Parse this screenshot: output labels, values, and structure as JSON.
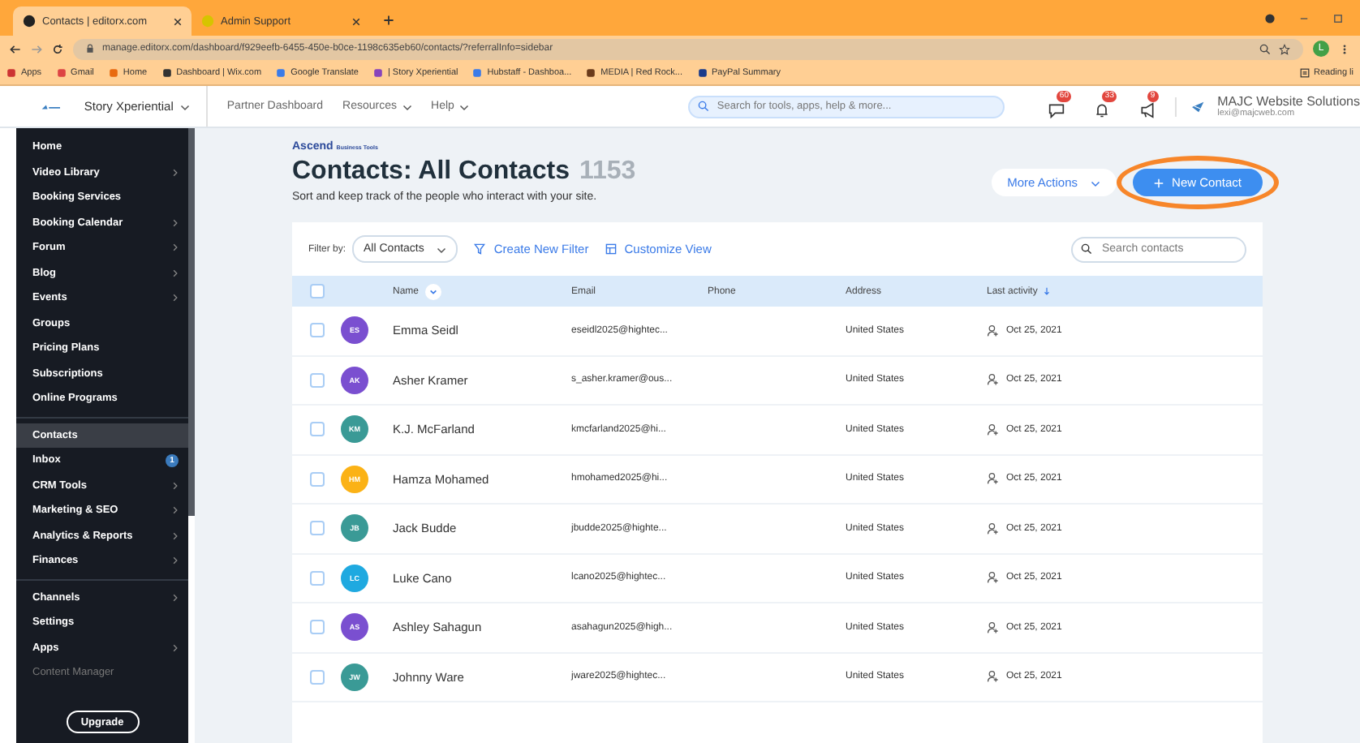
{
  "browser": {
    "tabs": [
      {
        "title": "Contacts | editorx.com",
        "selected": true
      },
      {
        "title": "Admin Support",
        "selected": false
      }
    ],
    "url": "manage.editorx.com/dashboard/f929eefb-6455-450e-b0ce-1198c635eb60/contacts/?referralInfo=sidebar",
    "profile_initial": "L",
    "bookmarks": [
      "Apps",
      "Gmail",
      "Home",
      "Dashboard | Wix.com",
      "Google Translate",
      "| Story Xperiential",
      "Hubstaff - Dashboa...",
      "MEDIA | Red Rock...",
      "PayPal Summary"
    ],
    "reading_list": "Reading li"
  },
  "topbar": {
    "site": "Story Xperiential",
    "menus": [
      "Partner Dashboard",
      "Resources",
      "Help"
    ],
    "search": {
      "placeholder": "Search for tools, apps, help & more..."
    },
    "notifications": [
      {
        "kind": "chat",
        "count": "60"
      },
      {
        "kind": "bell",
        "count": "33"
      },
      {
        "kind": "megaphone",
        "count": "9"
      }
    ],
    "account": {
      "name": "MAJC Website Solutions",
      "email": "lexi@majcweb.com"
    }
  },
  "sidebar": {
    "groups": [
      [
        {
          "label": "Home",
          "arrow": false,
          "selected": false,
          "disabled": false
        },
        {
          "label": "Video Library",
          "arrow": true,
          "selected": false,
          "disabled": false
        },
        {
          "label": "Booking Services",
          "arrow": false,
          "selected": false,
          "disabled": false
        },
        {
          "label": "Booking Calendar",
          "arrow": true,
          "selected": false,
          "disabled": false
        },
        {
          "label": "Forum",
          "arrow": true,
          "selected": false,
          "disabled": false
        },
        {
          "label": "Blog",
          "arrow": true,
          "selected": false,
          "disabled": false
        },
        {
          "label": "Events",
          "arrow": true,
          "selected": false,
          "disabled": false
        },
        {
          "label": "Groups",
          "arrow": false,
          "selected": false,
          "disabled": false
        },
        {
          "label": "Pricing Plans",
          "arrow": false,
          "selected": false,
          "disabled": false
        },
        {
          "label": "Subscriptions",
          "arrow": false,
          "selected": false,
          "disabled": false
        },
        {
          "label": "Online Programs",
          "arrow": false,
          "selected": false,
          "disabled": false
        }
      ],
      [
        {
          "label": "Contacts",
          "arrow": false,
          "selected": true,
          "disabled": false
        },
        {
          "label": "Inbox",
          "arrow": false,
          "badge": "1",
          "selected": false,
          "disabled": false
        },
        {
          "label": "CRM Tools",
          "arrow": true,
          "selected": false,
          "disabled": false
        },
        {
          "label": "Marketing & SEO",
          "arrow": true,
          "selected": false,
          "disabled": false
        },
        {
          "label": "Analytics & Reports",
          "arrow": true,
          "selected": false,
          "disabled": false
        },
        {
          "label": "Finances",
          "arrow": true,
          "selected": false,
          "disabled": false
        }
      ],
      [
        {
          "label": "Channels",
          "arrow": true,
          "selected": false,
          "disabled": false
        },
        {
          "label": "Settings",
          "arrow": false,
          "selected": false,
          "disabled": false
        },
        {
          "label": "Apps",
          "arrow": true,
          "selected": false,
          "disabled": false
        },
        {
          "label": "Content Manager",
          "arrow": false,
          "selected": false,
          "disabled": true
        }
      ]
    ],
    "upgrade": "Upgrade"
  },
  "page": {
    "brand": "Ascend",
    "brand_sub": "Business Tools",
    "title": "Contacts: All Contacts",
    "count": "1153",
    "subtitle": "Sort and keep track of the people who interact with your site.",
    "more_actions": "More Actions",
    "new_contact": {
      "label": "New Contact",
      "highlighted": true
    }
  },
  "filters": {
    "label": "Filter by:",
    "dropdown": "All Contacts",
    "create_filter": "Create New Filter",
    "customize": "Customize View",
    "search": {
      "placeholder": "Search contacts"
    }
  },
  "table": {
    "select_all": false,
    "columns": [
      "Name",
      "Email",
      "Phone",
      "Address",
      "Last activity"
    ],
    "rows": [
      {
        "initials": "ES",
        "color": "#7a4fd0",
        "name": "Emma Seidl",
        "email": "eseidl2025@hightec...",
        "address": "United States",
        "last_activity": "Oct 25, 2021",
        "checked": false
      },
      {
        "initials": "AK",
        "color": "#7a4fd0",
        "name": "Asher Kramer",
        "email": "s_asher.kramer@ous...",
        "address": "United States",
        "last_activity": "Oct 25, 2021",
        "checked": false
      },
      {
        "initials": "KM",
        "color": "#3a9a96",
        "name": "K.J. McFarland",
        "email": "kmcfarland2025@hi...",
        "address": "United States",
        "last_activity": "Oct 25, 2021",
        "checked": false
      },
      {
        "initials": "HM",
        "color": "#fbb216",
        "name": "Hamza Mohamed",
        "email": "hmohamed2025@hi...",
        "address": "United States",
        "last_activity": "Oct 25, 2021",
        "checked": false
      },
      {
        "initials": "JB",
        "color": "#3a9a96",
        "name": "Jack Budde",
        "email": "jbudde2025@highte...",
        "address": "United States",
        "last_activity": "Oct 25, 2021",
        "checked": false
      },
      {
        "initials": "LC",
        "color": "#1fa9e0",
        "name": "Luke Cano",
        "email": "lcano2025@hightec...",
        "address": "United States",
        "last_activity": "Oct 25, 2021",
        "checked": false
      },
      {
        "initials": "AS",
        "color": "#7a4fd0",
        "name": "Ashley Sahagun",
        "email": "asahagun2025@high...",
        "address": "United States",
        "last_activity": "Oct 25, 2021",
        "checked": false
      },
      {
        "initials": "JW",
        "color": "#3a9a96",
        "name": "Johnny Ware",
        "email": "jware2025@hightec...",
        "address": "United States",
        "last_activity": "Oct 25, 2021",
        "checked": false
      }
    ]
  }
}
